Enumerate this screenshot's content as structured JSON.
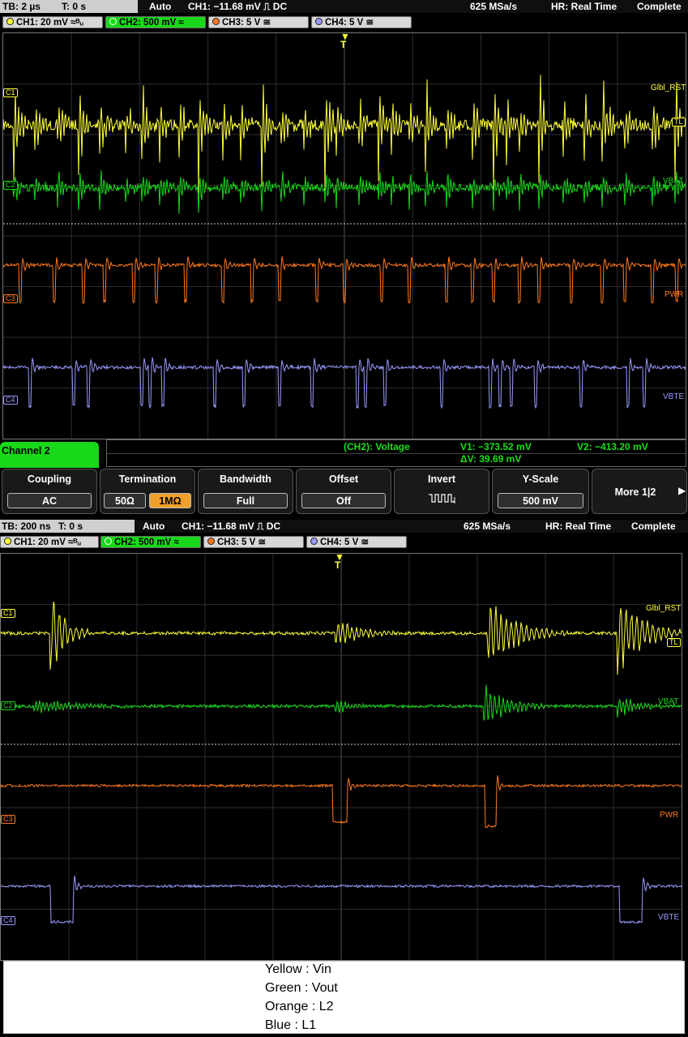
{
  "top": {
    "status": {
      "tb": "TB: 2 µs",
      "t": "T: 0 s",
      "mode": "Auto",
      "trigger": "CH1: −11.68 mV ⎍ DC",
      "rate": "625 MSa/s",
      "hr": "HR: Real Time",
      "state": "Complete"
    },
    "channels": [
      {
        "label": "CH1: 20 mV ≈ᴮᵤ",
        "color": "#ffff3a"
      },
      {
        "label": "CH2: 500 mV ≈",
        "color": "#19d819"
      },
      {
        "label": "CH3: 5 V ≅",
        "color": "#ff7a1e"
      },
      {
        "label": "CH4: 5 V ≅",
        "color": "#9a9aff"
      }
    ],
    "labels": {
      "c1": "C1",
      "c2": "C2",
      "c3": "C3",
      "c4": "C4",
      "glbl": "Glbl_RST",
      "vbat": "VBAT",
      "pwr": "PWR",
      "vbte": "VBTE",
      "tl": "TL",
      "trig": "T"
    }
  },
  "menu": {
    "title": "Channel 2",
    "measure_label": "(CH2): Voltage",
    "v1": "V1: −373.52 mV",
    "v2": "V2: −413.20 mV",
    "dv": "ΔV: 39.69 mV",
    "softkeys": {
      "coupling": {
        "title": "Coupling",
        "value": "AC"
      },
      "termination": {
        "title": "Termination",
        "opt1": "50Ω",
        "opt2": "1MΩ"
      },
      "bandwidth": {
        "title": "Bandwidth",
        "value": "Full"
      },
      "offset": {
        "title": "Offset",
        "value": "Off"
      },
      "invert": {
        "title": "Invert"
      },
      "yscale": {
        "title": "Y-Scale",
        "value": "500 mV"
      },
      "more": {
        "title": "More 1|2"
      }
    }
  },
  "bottom": {
    "status": {
      "tb": "TB: 200 ns",
      "t": "T: 0 s",
      "mode": "Auto",
      "trigger": "CH1: −11.68 mV ⎍ DC",
      "rate": "625 MSa/s",
      "hr": "HR: Real Time",
      "state": "Complete"
    },
    "channels": [
      {
        "label": "CH1: 20 mV ≈ᴮᵤ"
      },
      {
        "label": "CH2: 500 mV ≈"
      },
      {
        "label": "CH3: 5 V ≅"
      },
      {
        "label": "CH4: 5 V ≅"
      }
    ]
  },
  "legend": {
    "yellow": "Yellow : Vin",
    "green": "Green : Vout",
    "orange": "Orange : L2",
    "blue": "Blue : L1"
  },
  "colors": {
    "ch1": "#ffff3a",
    "ch2": "#19d819",
    "ch3": "#ff7a1e",
    "ch4": "#9a9aff"
  }
}
